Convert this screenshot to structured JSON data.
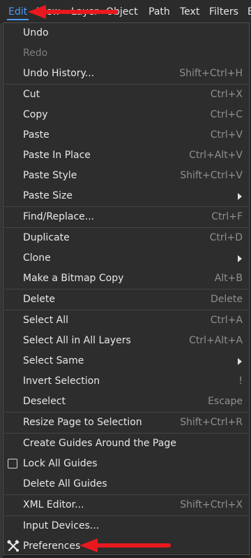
{
  "menubar": {
    "items": [
      "Edit",
      "View",
      "Layer",
      "Object",
      "Path",
      "Text",
      "Filters",
      "E"
    ]
  },
  "edit_menu": {
    "undo": {
      "label": "Undo"
    },
    "redo": {
      "label": "Redo"
    },
    "undo_history": {
      "label": "Undo History...",
      "shortcut": "Shift+Ctrl+H"
    },
    "cut": {
      "label": "Cut",
      "shortcut": "Ctrl+X"
    },
    "copy": {
      "label": "Copy",
      "shortcut": "Ctrl+C"
    },
    "paste": {
      "label": "Paste",
      "shortcut": "Ctrl+V"
    },
    "paste_in_place": {
      "label": "Paste In Place",
      "shortcut": "Ctrl+Alt+V"
    },
    "paste_style": {
      "label": "Paste Style",
      "shortcut": "Shift+Ctrl+V"
    },
    "paste_size": {
      "label": "Paste Size"
    },
    "find_replace": {
      "label": "Find/Replace...",
      "shortcut": "Ctrl+F"
    },
    "duplicate": {
      "label": "Duplicate",
      "shortcut": "Ctrl+D"
    },
    "clone": {
      "label": "Clone"
    },
    "make_bitmap_copy": {
      "label": "Make a Bitmap Copy",
      "shortcut": "Alt+B"
    },
    "delete": {
      "label": "Delete",
      "shortcut": "Delete"
    },
    "select_all": {
      "label": "Select All",
      "shortcut": "Ctrl+A"
    },
    "select_all_layers": {
      "label": "Select All in All Layers",
      "shortcut": "Ctrl+Alt+A"
    },
    "select_same": {
      "label": "Select Same"
    },
    "invert_selection": {
      "label": "Invert Selection",
      "shortcut": "!"
    },
    "deselect": {
      "label": "Deselect",
      "shortcut": "Escape"
    },
    "resize_page": {
      "label": "Resize Page to Selection",
      "shortcut": "Shift+Ctrl+R"
    },
    "create_guides": {
      "label": "Create Guides Around the Page"
    },
    "lock_guides": {
      "label": "Lock All Guides",
      "checked": false
    },
    "delete_guides": {
      "label": "Delete All Guides"
    },
    "xml_editor": {
      "label": "XML Editor...",
      "shortcut": "Shift+Ctrl+X"
    },
    "input_devices": {
      "label": "Input Devices..."
    },
    "preferences": {
      "label": "Preferences",
      "icon": "preferences-icon"
    }
  },
  "colors": {
    "accent": "#4a9eff",
    "annotation_arrow": "#e8191e"
  }
}
